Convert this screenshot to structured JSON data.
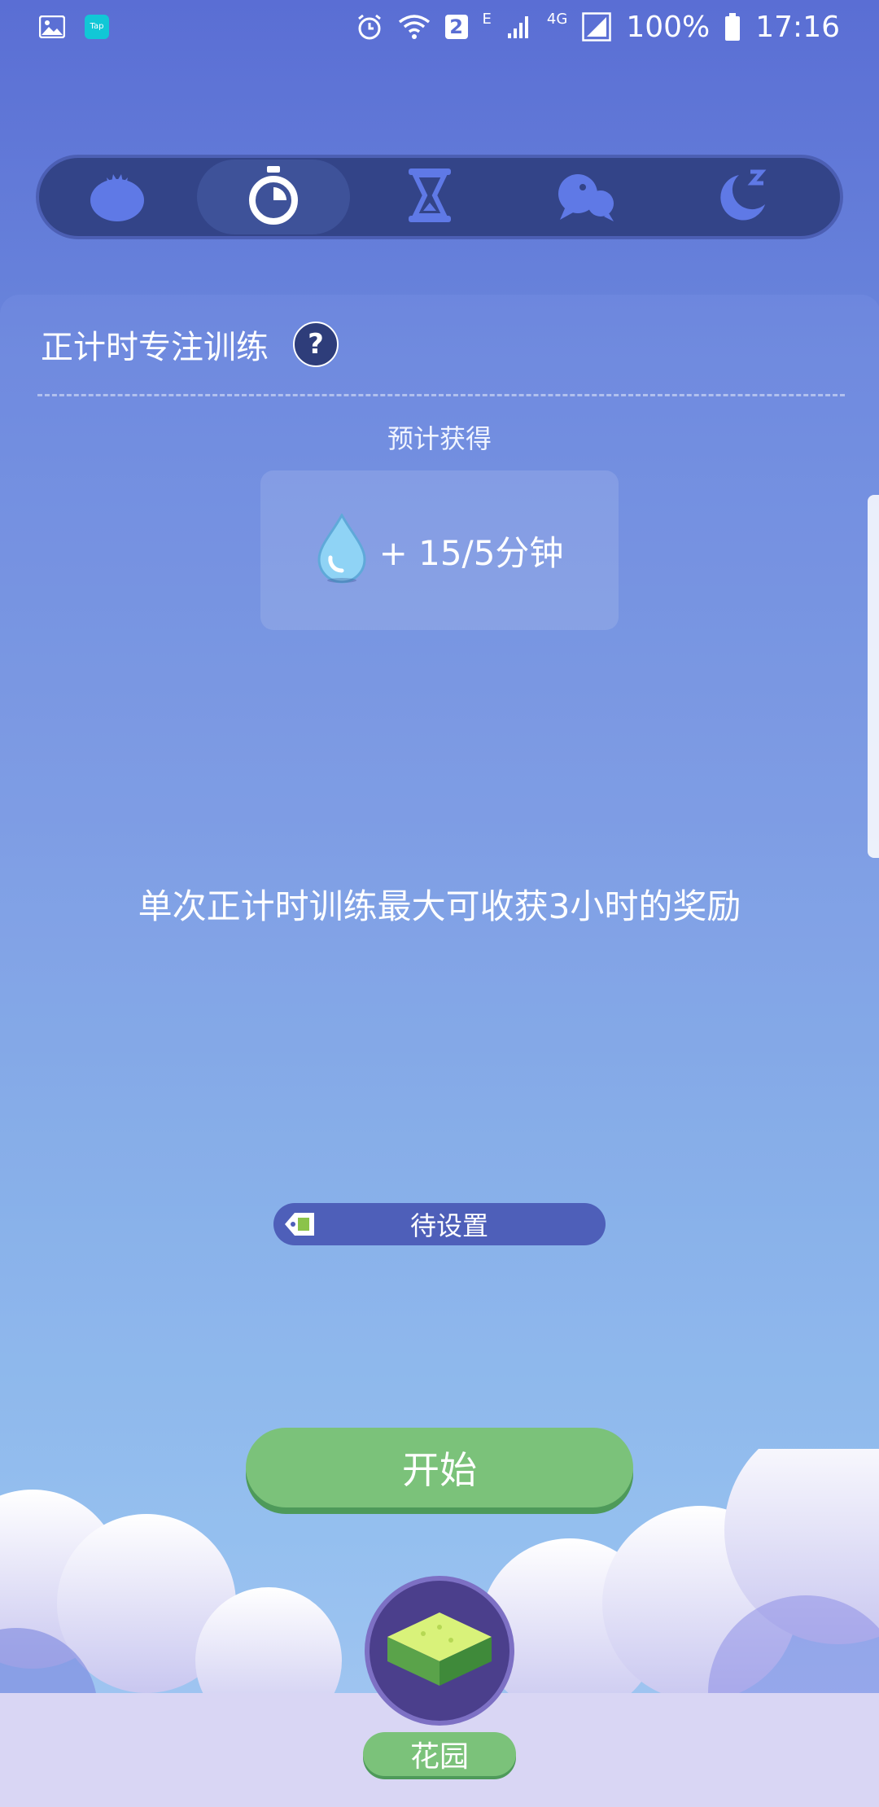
{
  "status_bar": {
    "left_icons": [
      "gallery-icon",
      "taptap-icon"
    ],
    "taptap_label": "Tap",
    "sim_number": "2",
    "network_e": "E",
    "network_4g": "4G",
    "battery_percent": "100%",
    "time": "17:16"
  },
  "mode_tabs": [
    {
      "icon": "tomato-icon",
      "active": false
    },
    {
      "icon": "stopwatch-icon",
      "active": true
    },
    {
      "icon": "hourglass-icon",
      "active": false
    },
    {
      "icon": "chat-bubbles-icon",
      "active": false
    },
    {
      "icon": "moon-sleep-icon",
      "active": false
    }
  ],
  "card": {
    "title": "正计时专注训练",
    "help_symbol": "?",
    "expected_label": "预计获得",
    "reward_text": "+ 15/5分钟",
    "reward_icon": "water-drop-icon",
    "tip": "单次正计时训练最大可收获3小时的奖励",
    "tag_text": "待设置"
  },
  "start_button": "开始",
  "garden": {
    "label": "花园",
    "icon": "grass-block-icon"
  },
  "colors": {
    "accent_green": "#7bc27a",
    "mode_bar_bg": "#334488",
    "tag_bg": "#4e5fb9"
  }
}
